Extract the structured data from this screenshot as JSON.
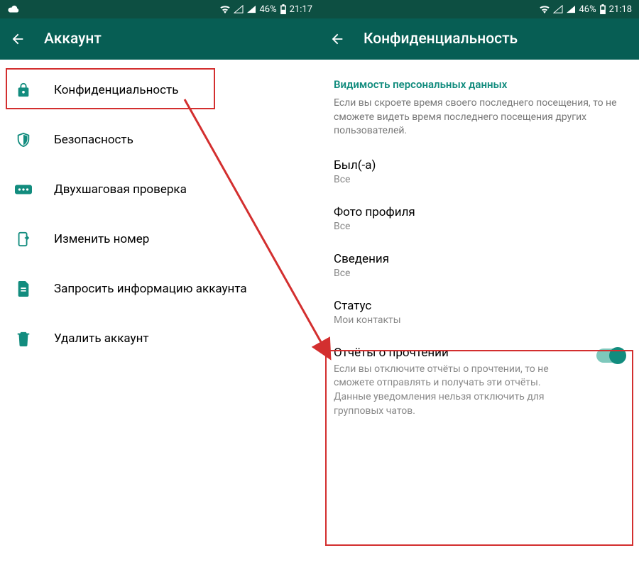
{
  "left": {
    "status": {
      "battery": "46%",
      "time": "21:17"
    },
    "appbar": {
      "title": "Аккаунт"
    },
    "menu": [
      {
        "label": "Конфиденциальность",
        "icon": "lock-icon"
      },
      {
        "label": "Безопасность",
        "icon": "shield-icon"
      },
      {
        "label": "Двухшаговая проверка",
        "icon": "sms-icon"
      },
      {
        "label": "Изменить номер",
        "icon": "phone-move-icon"
      },
      {
        "label": "Запросить информацию аккаунта",
        "icon": "document-icon"
      },
      {
        "label": "Удалить аккаунт",
        "icon": "trash-icon"
      }
    ]
  },
  "right": {
    "status": {
      "battery": "46%",
      "time": "21:18"
    },
    "appbar": {
      "title": "Конфиденциальность"
    },
    "section_header": "Видимость персональных данных",
    "section_desc": "Если вы скроете время своего последнего посещения, то не сможете видеть время последнего посещения других пользователей.",
    "settings": [
      {
        "title": "Был(-а)",
        "value": "Все"
      },
      {
        "title": "Фото профиля",
        "value": "Все"
      },
      {
        "title": "Сведения",
        "value": "Все"
      },
      {
        "title": "Статус",
        "value": "Мои контакты"
      }
    ],
    "read_receipts": {
      "title": "Отчёты о прочтении",
      "desc": "Если вы отключите отчёты о прочтении, то не сможете отправлять и получать эти отчёты. Данные уведомления нельзя отключить для групповых чатов."
    }
  }
}
